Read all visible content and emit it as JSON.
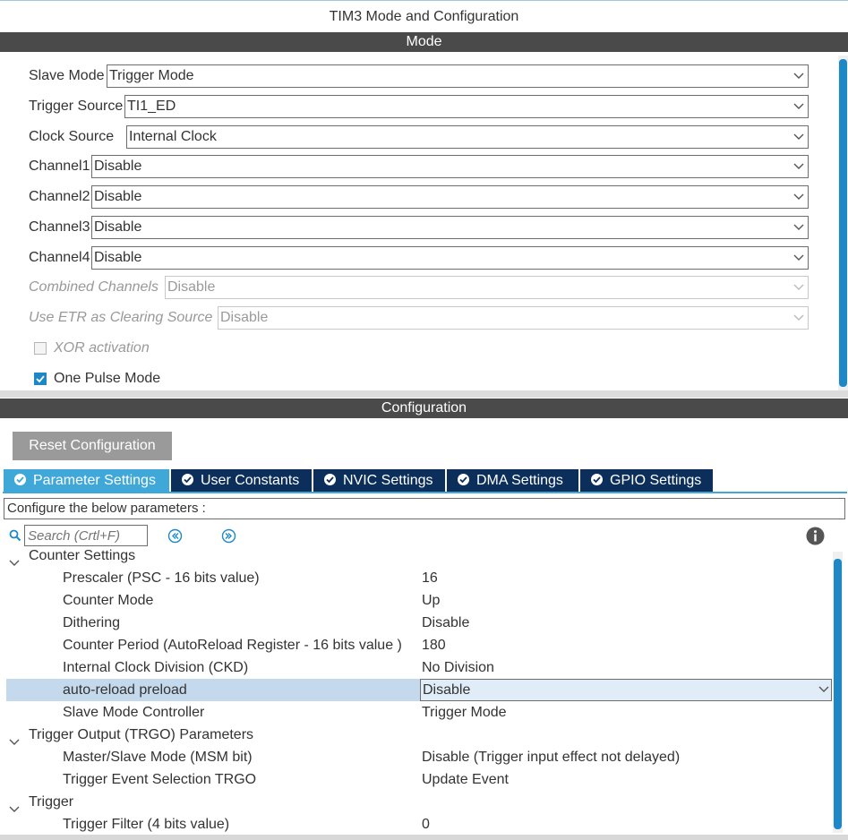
{
  "window": {
    "title": "TIM3 Mode and Configuration"
  },
  "mode": {
    "section_title": "Mode",
    "rows": [
      {
        "label": "Slave Mode",
        "value": "Trigger Mode"
      },
      {
        "label": "Trigger Source",
        "value": "TI1_ED"
      },
      {
        "label": "Clock Source",
        "value": "Internal Clock"
      },
      {
        "label": "Channel1",
        "value": "Disable"
      },
      {
        "label": "Channel2",
        "value": "Disable"
      },
      {
        "label": "Channel3",
        "value": "Disable"
      },
      {
        "label": "Channel4",
        "value": "Disable"
      },
      {
        "label": "Combined Channels",
        "value": "Disable"
      },
      {
        "label": "Use ETR as Clearing Source",
        "value": "Disable"
      }
    ],
    "checkboxes": [
      {
        "label": "XOR activation",
        "checked": false
      },
      {
        "label": "One Pulse Mode",
        "checked": true
      }
    ]
  },
  "configuration": {
    "section_title": "Configuration",
    "reset_label": "Reset Configuration",
    "tabs": [
      {
        "label": "Parameter Settings",
        "active": true
      },
      {
        "label": "User Constants",
        "active": false
      },
      {
        "label": "NVIC Settings",
        "active": false
      },
      {
        "label": "DMA Settings",
        "active": false
      },
      {
        "label": "GPIO Settings",
        "active": false
      }
    ],
    "hint": "Configure the below parameters :",
    "search_placeholder": "Search (Crtl+F)"
  },
  "parameters": {
    "groups": [
      {
        "name": "Counter Settings",
        "items": [
          {
            "name": "Prescaler (PSC - 16 bits value)",
            "value": "16"
          },
          {
            "name": "Counter Mode",
            "value": "Up"
          },
          {
            "name": "Dithering",
            "value": "Disable"
          },
          {
            "name": "Counter Period (AutoReload Register - 16 bits value )",
            "value": "180"
          },
          {
            "name": "Internal Clock Division (CKD)",
            "value": "No Division"
          },
          {
            "name": "auto-reload preload",
            "value": "Disable"
          },
          {
            "name": "Slave Mode Controller",
            "value": "Trigger Mode"
          }
        ]
      },
      {
        "name": "Trigger Output (TRGO) Parameters",
        "items": [
          {
            "name": "Master/Slave Mode (MSM bit)",
            "value": "Disable (Trigger input effect not delayed)"
          },
          {
            "name": "Trigger Event Selection TRGO",
            "value": "Update Event"
          }
        ]
      },
      {
        "name": "Trigger",
        "items": [
          {
            "name": "Trigger Filter (4 bits value)",
            "value": "0"
          }
        ]
      }
    ]
  },
  "colors": {
    "accent": "#1e88c7",
    "tab_active": "#3fa8d9",
    "tab_inactive": "#0b2e5a",
    "section_bar": "#4a4a4a",
    "selection": "#c5d9ec"
  }
}
